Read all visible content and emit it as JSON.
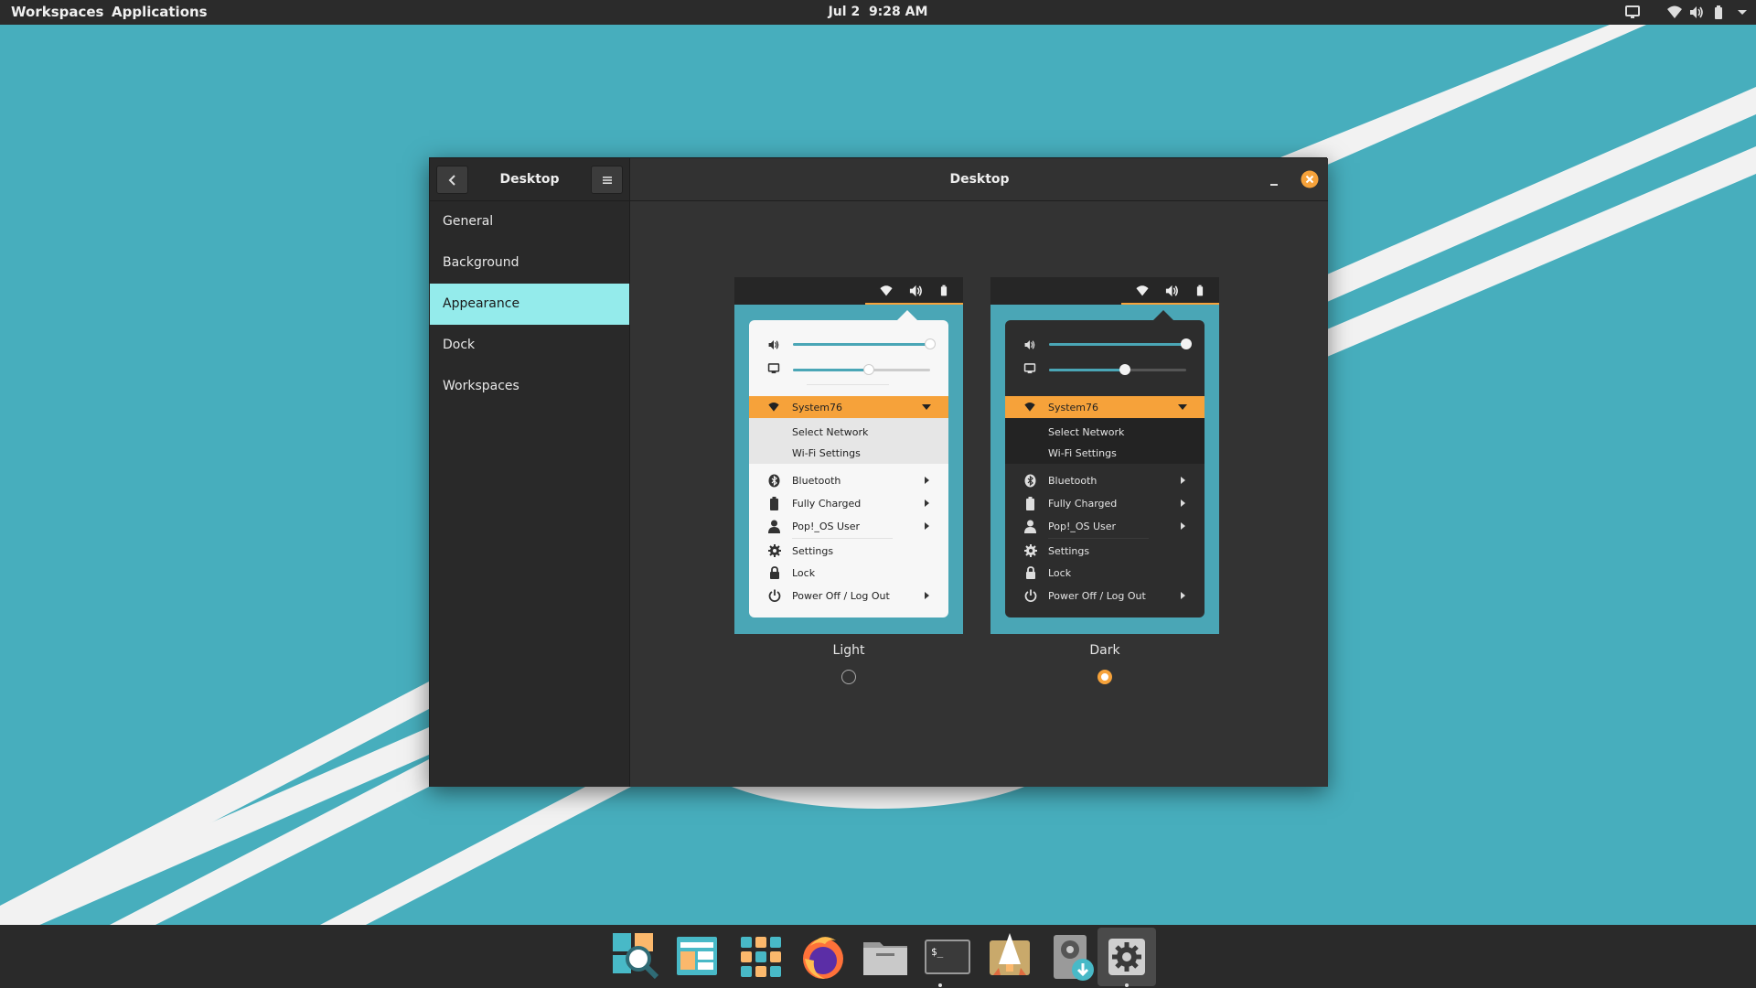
{
  "topbar": {
    "workspaces": "Workspaces",
    "applications": "Applications",
    "date": "Jul 2",
    "time": "9:28 AM",
    "tray_icons": [
      "display-icon",
      "wifi-icon",
      "volume-icon",
      "battery-icon"
    ]
  },
  "window": {
    "sidebar_title": "Desktop",
    "main_title": "Desktop",
    "back_icon": "chevron-left-icon",
    "menu_icon": "hamburger-icon",
    "minimize_icon": "minimize-icon",
    "close_icon": "close-icon",
    "sidebar_items": [
      {
        "label": "General"
      },
      {
        "label": "Background"
      },
      {
        "label": "Appearance",
        "active": true
      },
      {
        "label": "Dock"
      },
      {
        "label": "Workspaces"
      }
    ]
  },
  "appearance": {
    "light": {
      "label": "Light",
      "selected": false,
      "volume_level": 1.0,
      "brightness_level": 0.55,
      "network": "System76",
      "submenu": [
        "Select Network",
        "Wi-Fi Settings"
      ],
      "items": [
        "Bluetooth",
        "Fully Charged",
        "Pop!_OS User",
        "Settings",
        "Lock",
        "Power Off / Log Out"
      ]
    },
    "dark": {
      "label": "Dark",
      "selected": true,
      "volume_level": 1.0,
      "brightness_level": 0.55,
      "network": "System76",
      "submenu": [
        "Select Network",
        "Wi-Fi Settings"
      ],
      "items": [
        "Bluetooth",
        "Fully Charged",
        "Pop!_OS User",
        "Settings",
        "Lock",
        "Power Off / Log Out"
      ]
    }
  },
  "dock": {
    "items": [
      {
        "name": "search-app-icon",
        "running": false
      },
      {
        "name": "files-app-icon",
        "running": false
      },
      {
        "name": "app-grid-icon",
        "running": false
      },
      {
        "name": "firefox-icon",
        "running": false
      },
      {
        "name": "file-manager-icon",
        "running": false
      },
      {
        "name": "terminal-icon",
        "running": true
      },
      {
        "name": "pop-shop-icon",
        "running": false
      },
      {
        "name": "installer-icon",
        "running": false
      },
      {
        "name": "settings-app-icon",
        "running": true,
        "active": true
      }
    ]
  },
  "colors": {
    "accent": "#f6a23a",
    "selection": "#94ebeb",
    "wallpaper": "#47aebd",
    "panel": "#2b2b2b"
  }
}
